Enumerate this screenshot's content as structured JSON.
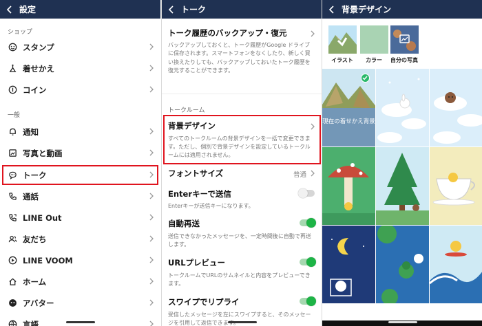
{
  "settings": {
    "title": "設定",
    "sections": [
      {
        "label": "ショップ"
      },
      {
        "label": "一般"
      }
    ],
    "items": [
      {
        "label": "スタンプ",
        "icon": "smiley-icon"
      },
      {
        "label": "着せかえ",
        "icon": "theme-icon"
      },
      {
        "label": "コイン",
        "icon": "coin-icon"
      },
      {
        "label": "通知",
        "icon": "bell-icon"
      },
      {
        "label": "写真と動画",
        "icon": "photo-icon"
      },
      {
        "label": "トーク",
        "icon": "chat-bubble-icon"
      },
      {
        "label": "通話",
        "icon": "phone-icon"
      },
      {
        "label": "LINE Out",
        "icon": "line-out-icon"
      },
      {
        "label": "友だち",
        "icon": "friends-icon"
      },
      {
        "label": "LINE VOOM",
        "icon": "voom-icon"
      },
      {
        "label": "ホーム",
        "icon": "home-icon"
      },
      {
        "label": "アバター",
        "icon": "avatar-icon"
      },
      {
        "label": "言語",
        "icon": "language-icon"
      }
    ]
  },
  "talk": {
    "title": "トーク",
    "backup": {
      "title": "トーク履歴のバックアップ・復元",
      "desc": "バックアップしておくと、トーク履歴がGoogle ドライブに保存されます。スマートフォンをなくしたり、新しく買い換えたりしても、バックアップしておいたトーク履歴を復元することができます。"
    },
    "section_label": "トークルーム",
    "background": {
      "title": "背景デザイン",
      "desc": "すべてのトークルームの背景デザインを一括で変更できます。ただし、個別で背景デザインを設定しているトークルームには適用されません。"
    },
    "font_size": {
      "title": "フォントサイズ",
      "value": "普通"
    },
    "enter_send": {
      "title": "Enterキーで送信",
      "desc": "Enterキーが送信キーになります。"
    },
    "auto_resend": {
      "title": "自動再送",
      "desc": "送信できなかったメッセージを、一定時間後に自動で再送します。"
    },
    "url_preview": {
      "title": "URLプレビュー",
      "desc": "トークルームでURLのサムネイルと内容をプレビューできます。"
    },
    "swipe_reply": {
      "title": "スワイプでリプライ",
      "desc": "受信したメッセージを左にスワイプすると、そのメッセージを引用して返信できます。"
    }
  },
  "background_design": {
    "title": "背景デザイン",
    "options": [
      {
        "label": "イラスト"
      },
      {
        "label": "カラー"
      },
      {
        "label": "自分の写真"
      }
    ],
    "current_label": "現在の着せかえ背景"
  },
  "colors": {
    "header_bg": "#1f3152",
    "highlight": "#e0141e",
    "toggle_on": "#1db446",
    "selected_check": "#2ab96a"
  }
}
